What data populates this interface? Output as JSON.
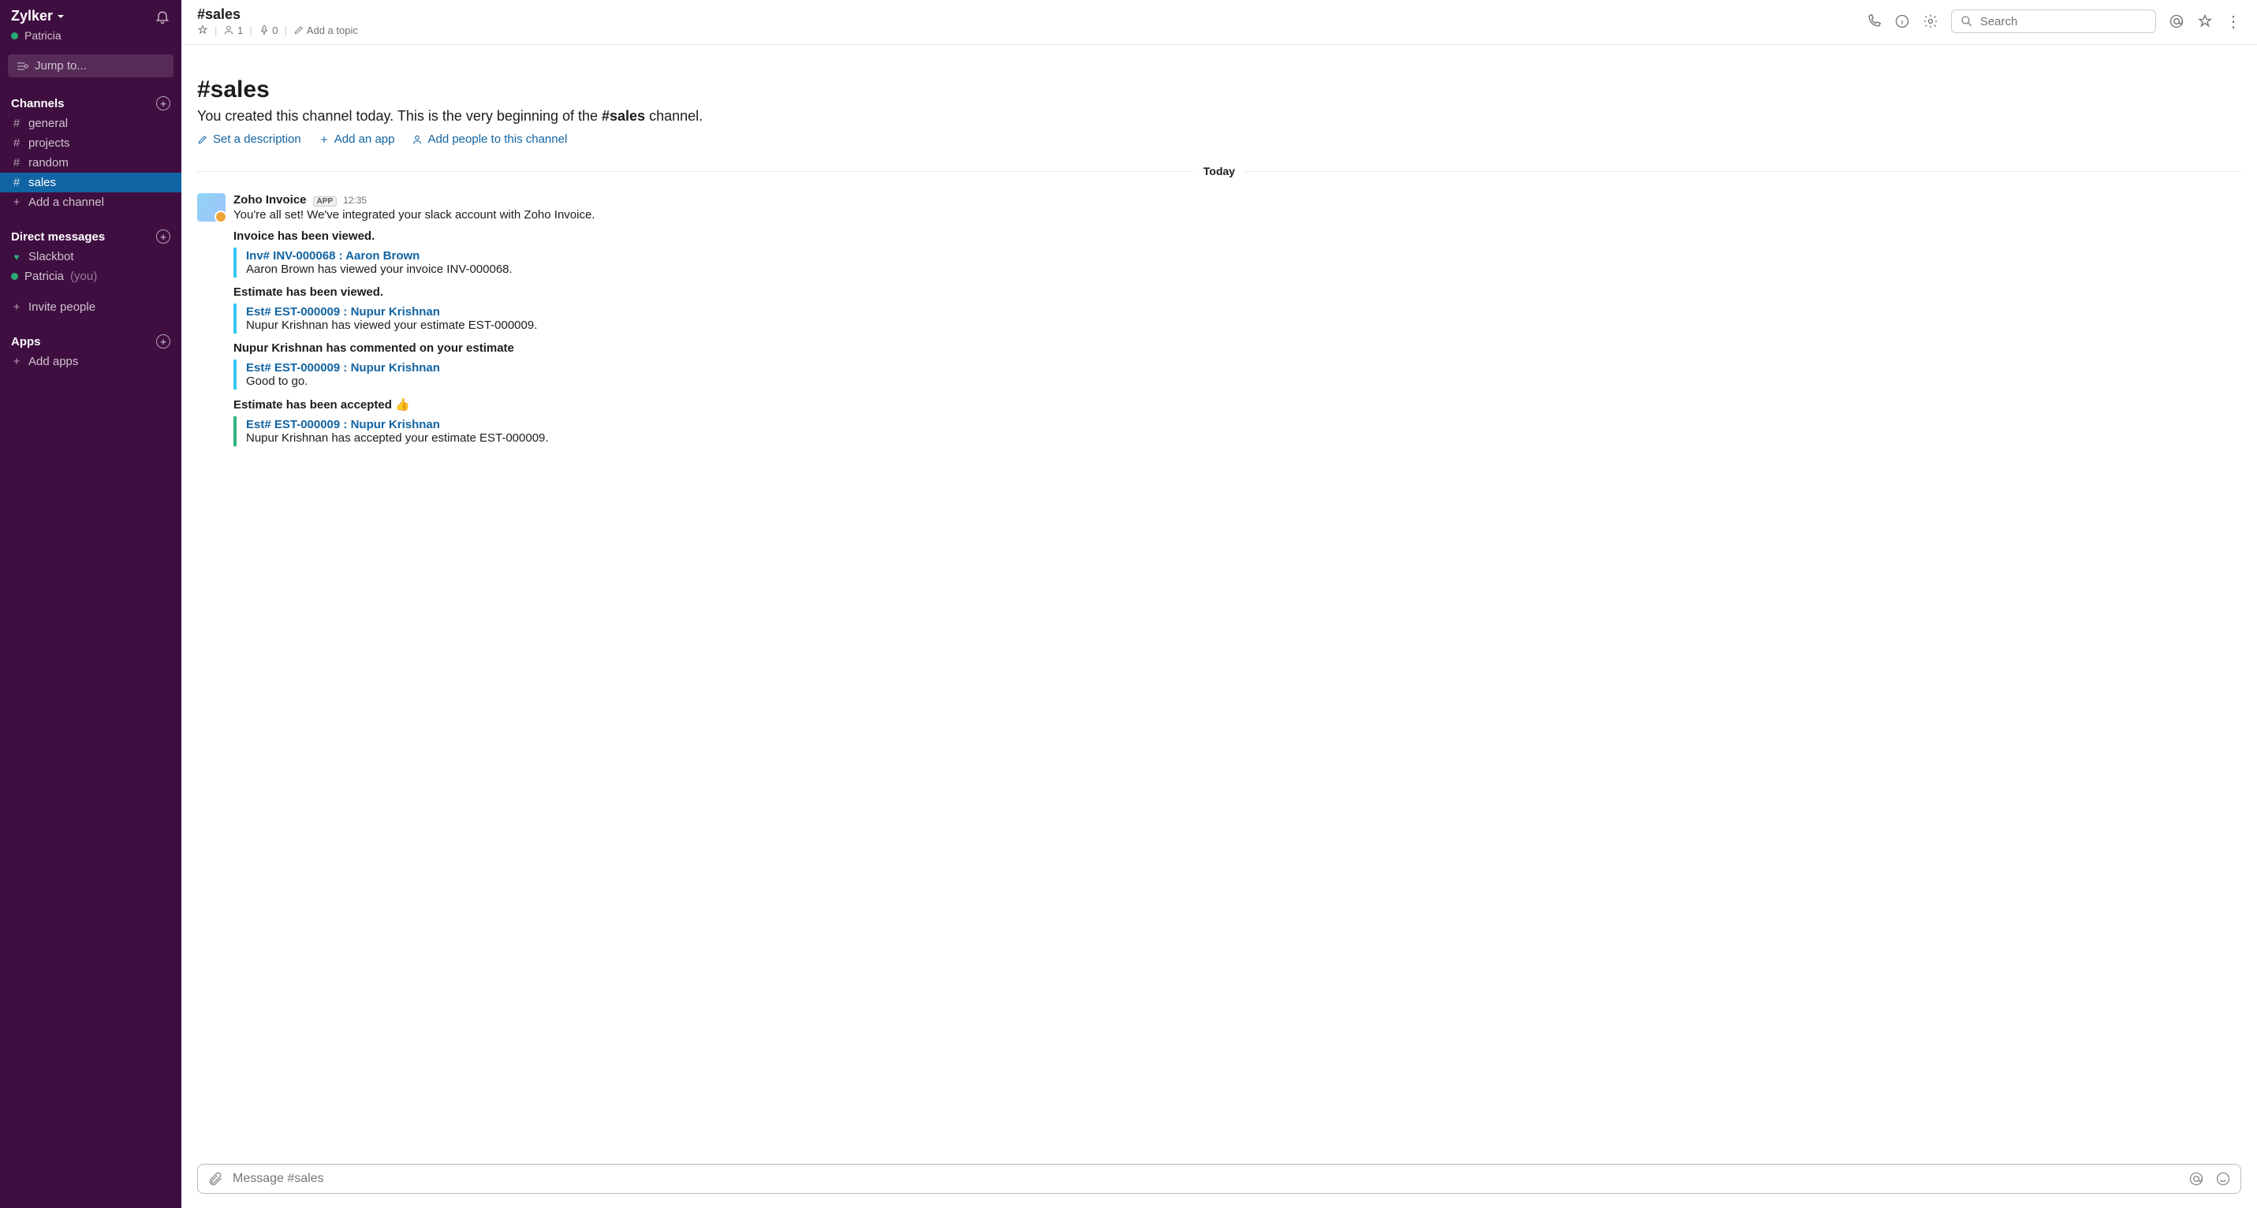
{
  "workspace": {
    "name": "Zylker",
    "user": "Patricia",
    "jump_placeholder": "Jump to..."
  },
  "sidebar": {
    "channels_heading": "Channels",
    "channels": [
      {
        "name": "general",
        "active": false
      },
      {
        "name": "projects",
        "active": false
      },
      {
        "name": "random",
        "active": false
      },
      {
        "name": "sales",
        "active": true
      }
    ],
    "add_channel": "Add a channel",
    "dm_heading": "Direct messages",
    "dms": [
      {
        "name": "Slackbot",
        "you": false,
        "heart": true
      },
      {
        "name": "Patricia",
        "you": true,
        "heart": false
      }
    ],
    "invite": "Invite people",
    "apps_heading": "Apps",
    "add_apps": "Add apps"
  },
  "chHeader": {
    "name": "#sales",
    "members": "1",
    "pins": "0",
    "topic_placeholder": "Add a topic",
    "search_placeholder": "Search"
  },
  "intro": {
    "title": "#sales",
    "line_prefix": "You created this channel today. This is the very beginning of the ",
    "line_channel": "#sales",
    "line_suffix": " channel.",
    "set_desc": "Set a description",
    "add_app": "Add an app",
    "add_people": "Add people to this channel"
  },
  "divider": "Today",
  "msg": {
    "author": "Zoho Invoice",
    "badge": "APP",
    "time": "12:35",
    "intro_line": "You're all set! We've integrated your slack account with Zoho Invoice.",
    "sections": [
      {
        "heading": "Invoice has been viewed.",
        "color": "blue",
        "title": "Inv# INV-000068 : Aaron Brown",
        "text": "Aaron Brown has viewed your invoice INV-000068."
      },
      {
        "heading": "Estimate has been viewed.",
        "color": "blue",
        "title": "Est# EST-000009 : Nupur Krishnan",
        "text": "Nupur Krishnan has viewed your estimate EST-000009."
      },
      {
        "heading": "Nupur Krishnan has commented on your estimate",
        "color": "blue",
        "title": "Est# EST-000009 : Nupur Krishnan",
        "text": "Good to go."
      },
      {
        "heading": "Estimate has been accepted 👍",
        "color": "green",
        "title": "Est# EST-000009 : Nupur Krishnan",
        "text": "Nupur Krishnan has accepted your estimate EST-000009."
      }
    ]
  },
  "composer": {
    "placeholder": "Message #sales"
  }
}
